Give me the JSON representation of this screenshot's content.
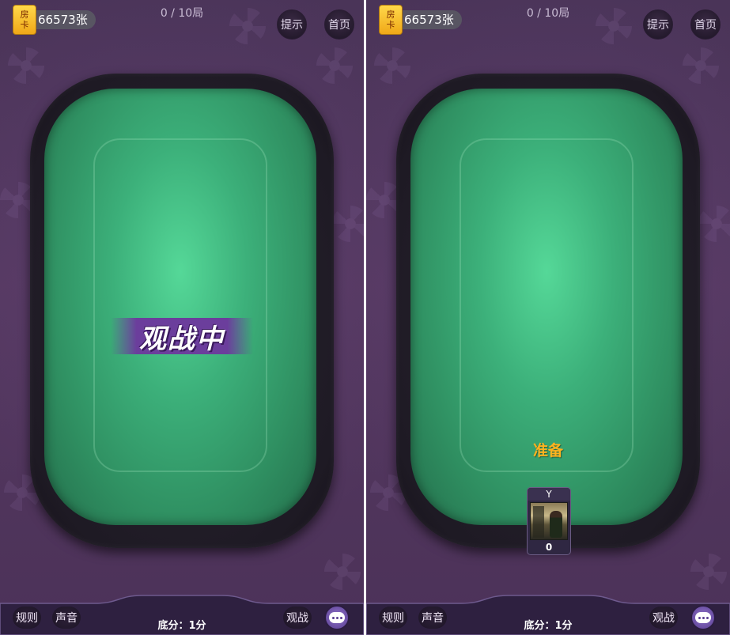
{
  "panels": [
    {
      "room_card": {
        "icon_line1": "房",
        "icon_line2": "卡",
        "count": "66573张"
      },
      "rounds": "0 / 10局",
      "hint_label": "提示",
      "home_label": "首页",
      "status_banner": "观战中",
      "bottom": {
        "rules_label": "规则",
        "sound_label": "声音",
        "watch_label": "观战",
        "base_score": "底分：1分"
      }
    },
    {
      "room_card": {
        "icon_line1": "房",
        "icon_line2": "卡",
        "count": "66573张"
      },
      "rounds": "0 / 10局",
      "hint_label": "提示",
      "home_label": "首页",
      "ready_label": "准备",
      "player": {
        "name": "Y",
        "score": "0"
      },
      "bottom": {
        "rules_label": "规则",
        "sound_label": "声音",
        "watch_label": "观战",
        "base_score": "底分：1分"
      }
    }
  ],
  "icons": [
    "chat-icon"
  ],
  "colors": {
    "felt": "#3cb07a",
    "background": "#4a3458",
    "ready": "#ffb21e",
    "banner": "#6b3e9c",
    "card_gold": "#f0a818"
  }
}
